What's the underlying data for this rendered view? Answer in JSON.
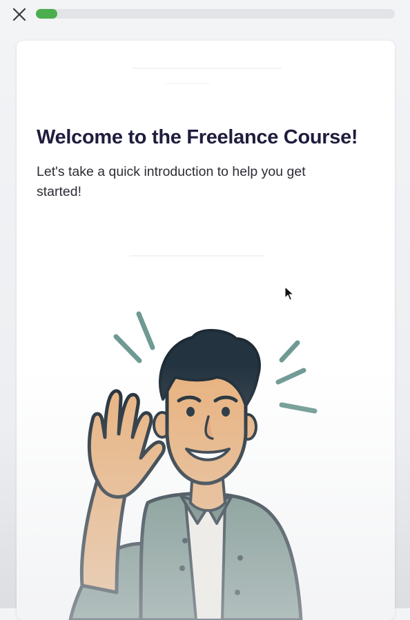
{
  "progress": {
    "value_fraction": 0.06,
    "color": "#4cae4f"
  },
  "card": {
    "title": "Welcome to the Freelance Course!",
    "subtitle": "Let's take a quick introduction to help you get started!"
  },
  "icons": {
    "close": "close-icon",
    "cursor": "mouse-pointer-icon",
    "illustration": "waving-man-illustration"
  },
  "colors": {
    "title": "#1f1d3d",
    "shirt": "#6f8b84",
    "motion_lines": "#6f9a93"
  }
}
